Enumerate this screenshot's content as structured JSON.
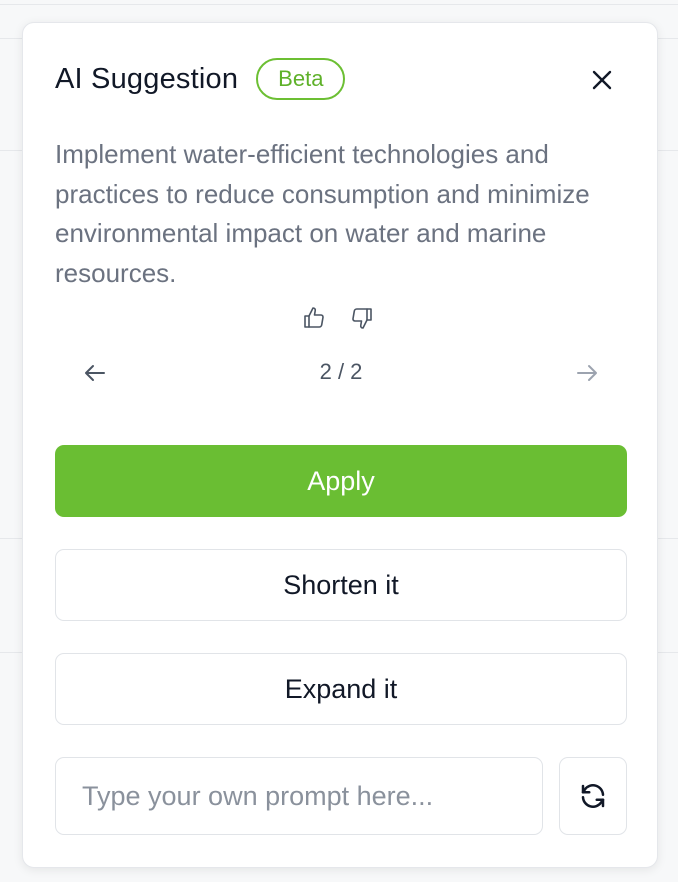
{
  "panel": {
    "title": "AI Suggestion",
    "badge": "Beta",
    "suggestion_text": "Implement water-efficient technologies and practices to reduce consumption and minimize environmental impact on water and marine resources.",
    "pager": {
      "current": 2,
      "total": 2,
      "label": "2 / 2"
    },
    "apply_label": "Apply",
    "shorten_label": "Shorten it",
    "expand_label": "Expand it",
    "prompt_placeholder": "Type your own prompt here...",
    "prompt_value": ""
  },
  "icons": {
    "close": "close-icon",
    "thumbs_up": "thumbs-up-icon",
    "thumbs_down": "thumbs-down-icon",
    "prev": "arrow-left-icon",
    "next": "arrow-right-icon",
    "refresh": "refresh-icon"
  },
  "colors": {
    "accent_green": "#6abe33",
    "badge_green": "#5fb12a",
    "text_primary": "#111827",
    "text_muted": "#6b7280"
  }
}
